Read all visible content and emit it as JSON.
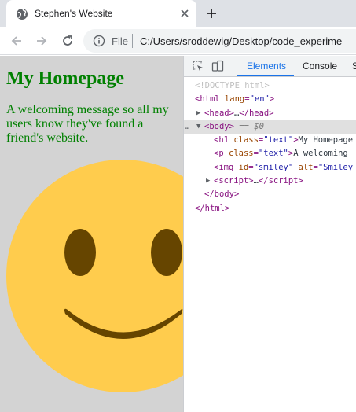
{
  "tab": {
    "title": "Stephen's Website"
  },
  "address_bar": {
    "scheme_label": "File",
    "url": "C:/Users/sroddewig/Desktop/code_experime"
  },
  "page": {
    "heading": "My Homepage",
    "paragraph": "A welcoming message so all my users know they've found a friend's website."
  },
  "devtools": {
    "tabs": [
      {
        "label": "Elements",
        "active": true
      },
      {
        "label": "Console",
        "active": false
      },
      {
        "label": "S",
        "active": false
      }
    ],
    "dom": {
      "doctype": "<!DOCTYPE html>",
      "html_open_tag": "html",
      "html_attr_name": "lang",
      "html_attr_value": "\"en\"",
      "head": "head",
      "head_ellipsis": "…",
      "body": "body",
      "body_marker": "== $0",
      "selected_dots": "…",
      "h1_attr_name": "class",
      "h1_attr_value": "\"text\"",
      "h1_text": "My Homepage",
      "p_attr_name": "class",
      "p_attr_value": "\"text\"",
      "p_text": "A welcoming",
      "img_id_name": "id",
      "img_id_value": "\"smiley\"",
      "img_alt_name": "alt",
      "img_alt_value": "\"Smiley",
      "script": "script",
      "script_ellipsis": "…",
      "h1_tag": "h1",
      "p_tag": "p",
      "img_tag": "img"
    }
  },
  "colors": {
    "page_bg": "#d3d3d3",
    "text_green": "#008000",
    "smiley_face": "#ffcc4d",
    "smiley_features": "#664500",
    "devtools_accent": "#1a73e8"
  }
}
